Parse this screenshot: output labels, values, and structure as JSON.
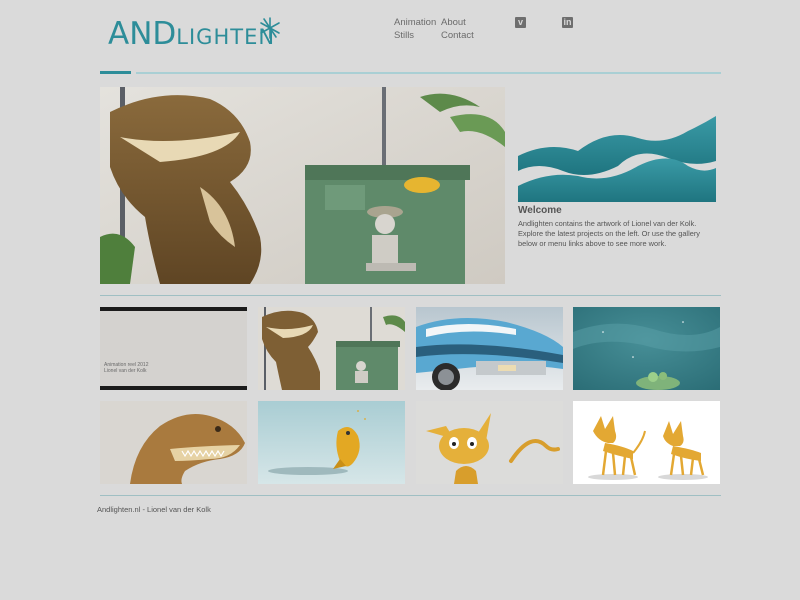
{
  "logo": {
    "text_main": "AND",
    "text_small": "LIGHTEN"
  },
  "nav": {
    "animation": "Animation",
    "stills": "Stills",
    "about": "About",
    "contact": "Contact"
  },
  "social": {
    "vimeo": "v",
    "linkedin": "in"
  },
  "welcome": {
    "title": "Welcome",
    "text": "Andlighten contains the artwork of Lionel van der Kolk. Explore the latest projects on the left. Or use the gallery below or menu links above to see more work."
  },
  "gallery": {
    "reel_line1": "Animation reel 2012",
    "reel_line2": "Lionel van der Kolk"
  },
  "footer": {
    "text": "Andlighten.nl - Lionel van der Kolk"
  },
  "colors": {
    "accent": "#2d8d99",
    "rule": "#a9cfd4",
    "background": "#dadada"
  }
}
